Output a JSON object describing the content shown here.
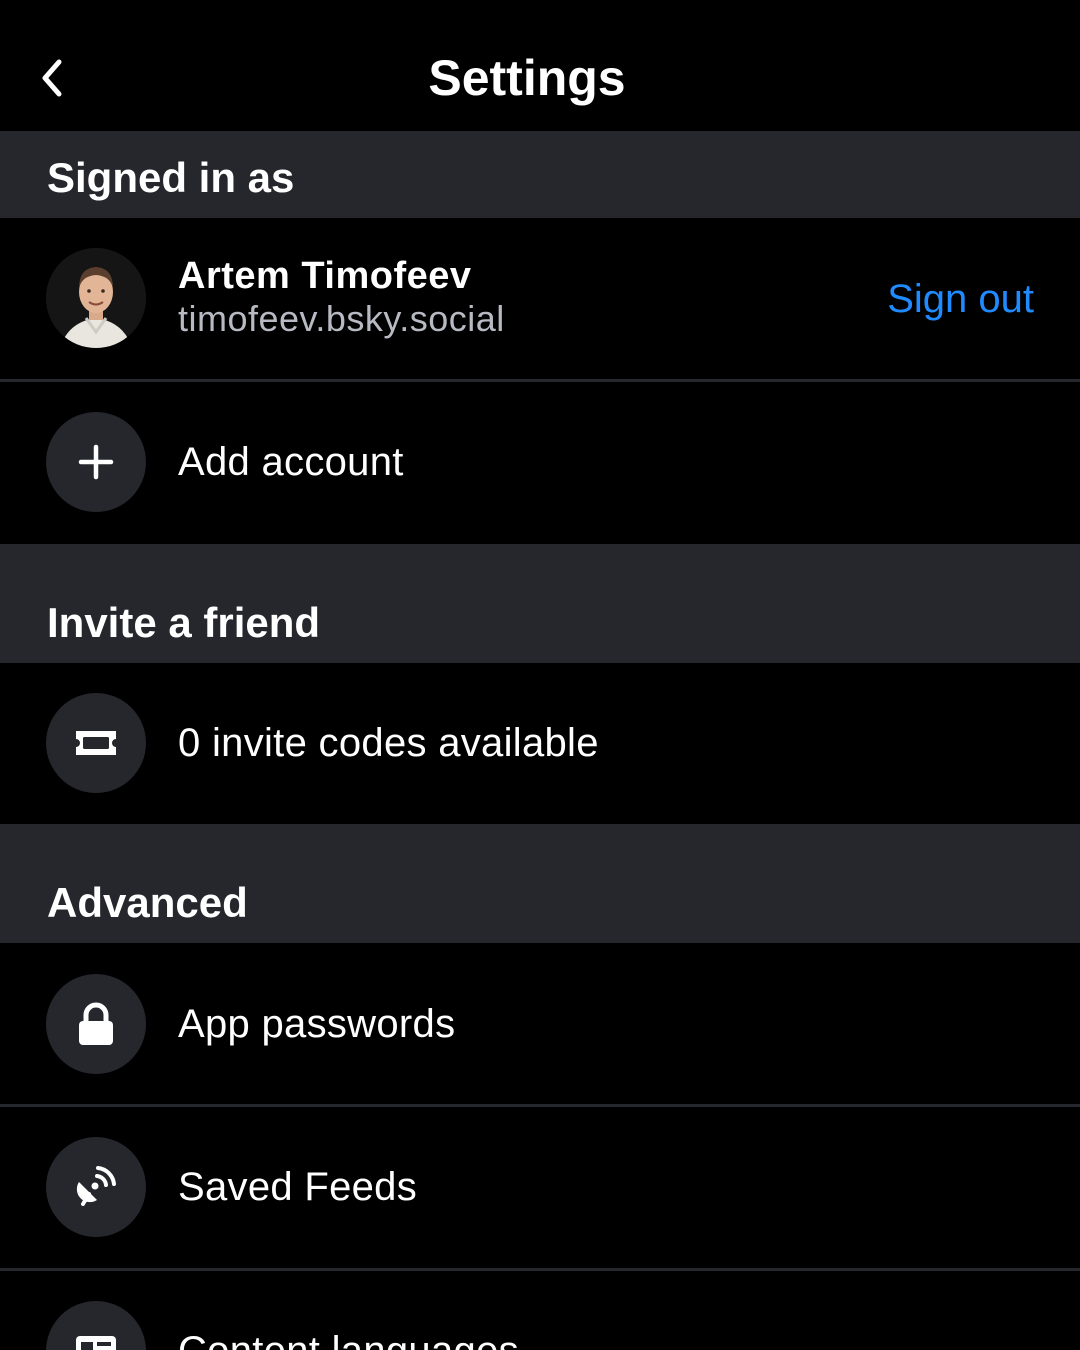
{
  "header": {
    "title": "Settings",
    "back_icon": "chevron-left-icon"
  },
  "signed_in": {
    "section_label": "Signed in as",
    "account": {
      "display_name": "Artem Timofeev",
      "handle": "timofeev.bsky.social",
      "sign_out_label": "Sign out"
    },
    "add_account_label": "Add account",
    "add_account_icon": "plus-icon"
  },
  "invite": {
    "section_label": "Invite a friend",
    "codes_label": "0 invite codes available",
    "codes_icon": "ticket-icon"
  },
  "advanced": {
    "section_label": "Advanced",
    "items": [
      {
        "label": "App passwords",
        "icon": "lock-icon"
      },
      {
        "label": "Saved Feeds",
        "icon": "satellite-dish-icon"
      },
      {
        "label": "Content languages",
        "icon": "language-card-icon"
      }
    ]
  },
  "colors": {
    "background": "#000000",
    "section_background": "#26272d",
    "accent": "#208bfe",
    "secondary_text": "#b7bac2"
  }
}
